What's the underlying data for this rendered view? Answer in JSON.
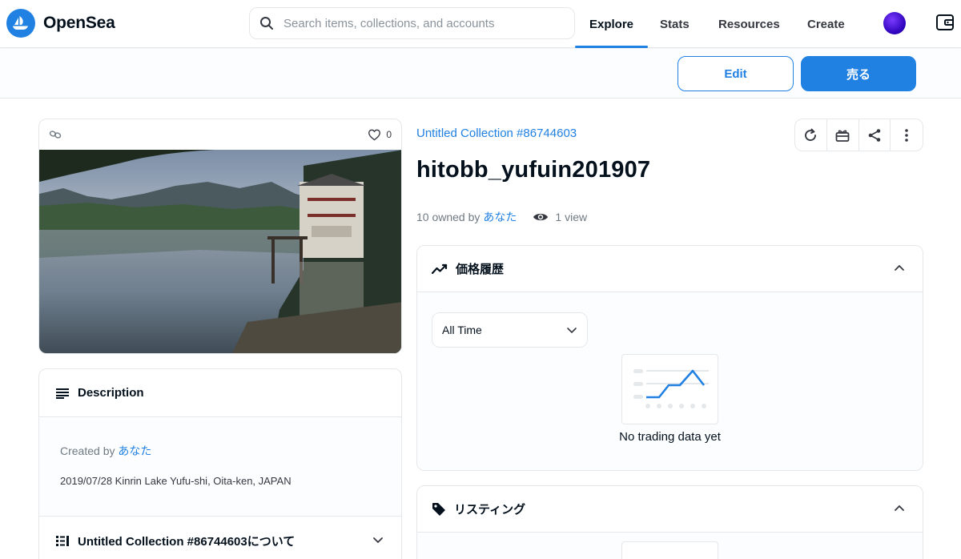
{
  "nav": {
    "brand": "OpenSea",
    "search_placeholder": "Search items, collections, and accounts",
    "links": [
      "Explore",
      "Stats",
      "Resources",
      "Create"
    ],
    "active_link": "Explore"
  },
  "actions": {
    "edit_label": "Edit",
    "sell_label": "売る"
  },
  "image_card": {
    "favorites": "0"
  },
  "description": {
    "header": "Description",
    "created_by_prefix": "Created by",
    "creator": "あなた",
    "text": "2019/07/28 Kinrin Lake Yufu-shi, Oita-ken, JAPAN",
    "about_header": "Untitled Collection #86744603について"
  },
  "item": {
    "collection": "Untitled Collection #86744603",
    "title": "hitobb_yufuin201907",
    "owned_prefix": "10 owned by",
    "owner": "あなた",
    "views": "1 view"
  },
  "price_history": {
    "header": "価格履歴",
    "range_selected": "All Time",
    "empty_text": "No trading data yet"
  },
  "listings": {
    "header": "リスティング"
  },
  "colors": {
    "accent": "#2081e2",
    "text": "#04111d",
    "muted": "#707a83",
    "border": "#e5e8eb"
  }
}
